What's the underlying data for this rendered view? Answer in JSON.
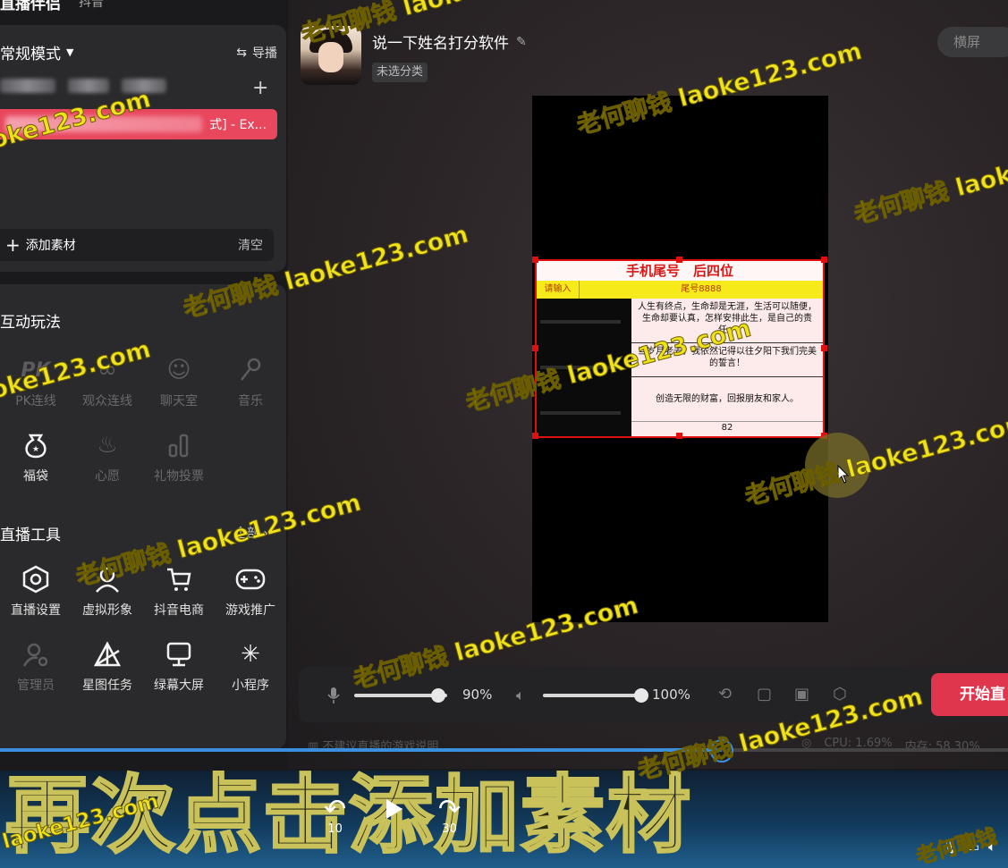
{
  "app": {
    "title": "直播伴侣",
    "platform": "抖音"
  },
  "scenes": {
    "mode_label": "常规模式",
    "guide_label": "导播",
    "active_scene_tail": "式] - Ex...",
    "add_material": "添加素材",
    "clear": "清空"
  },
  "interactive": {
    "title": "互动玩法",
    "items": [
      {
        "label": "PK连线",
        "icon": "pk-icon",
        "enabled": false
      },
      {
        "label": "观众连线",
        "icon": "link-icon",
        "enabled": false
      },
      {
        "label": "聊天室",
        "icon": "chat-room-icon",
        "enabled": false
      },
      {
        "label": "音乐",
        "icon": "microphone-icon",
        "enabled": false
      },
      {
        "label": "福袋",
        "icon": "lucky-bag-icon",
        "enabled": true
      },
      {
        "label": "心愿",
        "icon": "wish-lamp-icon",
        "enabled": false
      },
      {
        "label": "礼物投票",
        "icon": "gift-vote-icon",
        "enabled": false
      }
    ]
  },
  "tools": {
    "title": "直播工具",
    "all_label": "全部",
    "items": [
      {
        "label": "直播设置",
        "icon": "hexagon-settings-icon",
        "enabled": true
      },
      {
        "label": "虚拟形象",
        "icon": "avatar-icon",
        "enabled": true
      },
      {
        "label": "抖音电商",
        "icon": "cart-icon",
        "enabled": true
      },
      {
        "label": "游戏推广",
        "icon": "gamepad-icon",
        "enabled": true
      },
      {
        "label": "管理员",
        "icon": "admin-icon",
        "enabled": false
      },
      {
        "label": "星图任务",
        "icon": "star-map-icon",
        "enabled": true
      },
      {
        "label": "绿幕大屏",
        "icon": "screen-icon",
        "enabled": true
      },
      {
        "label": "小程序",
        "icon": "mini-program-icon",
        "enabled": true
      }
    ]
  },
  "stream": {
    "title": "说一下姓名打分软件",
    "category": "未选分类",
    "orientation_button": "横屏"
  },
  "preview_card": {
    "header": "手机尾号　后四位",
    "input_label": "请输入",
    "input_value": "尾号8888",
    "cells": [
      "人生有终点，生命却是无涯，生活可以随便，生命却要认真，怎样安排此生，是自己的责任。",
      "当岁月老去，我依然记得以往夕阳下我们完美的誓言！",
      "创造无限的财富，回报朋友和家人。",
      "82"
    ]
  },
  "audio": {
    "mic_volume": "90%",
    "mic_level": 0.9,
    "speaker_volume": "100%",
    "speaker_level": 1.0,
    "start_button": "开始直"
  },
  "status": {
    "hint": "不建议直播的游戏说明",
    "cpu": "CPU: 1.69%",
    "mem": "内存: 58.30%"
  },
  "player": {
    "progress": 0.716,
    "rewind": "10",
    "forward": "30"
  },
  "caption": "再次点击添加素材",
  "watermark": {
    "cn": "老何聊钱",
    "url": "laoke123.com"
  },
  "colors": {
    "accent_red": "#e0364d",
    "watermark": "#f0e21a",
    "progress_blue": "#3a8fe0"
  }
}
